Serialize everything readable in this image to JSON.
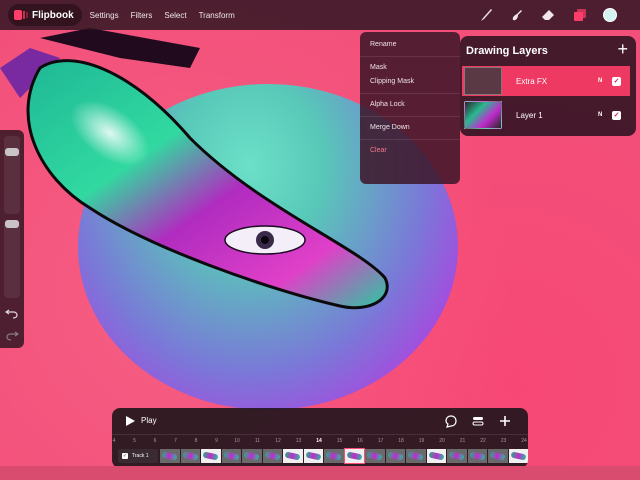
{
  "app": {
    "name": "Flipbook"
  },
  "menu": [
    "Settings",
    "Filters",
    "Select",
    "Transform"
  ],
  "toolbar": {
    "tools": [
      "brush-icon",
      "smudge-icon",
      "eraser-icon",
      "layers-icon"
    ],
    "active_tool": "layers-icon",
    "current_color": "#d4f2f2",
    "accent_color": "#ee3a63"
  },
  "context_menu": {
    "items": [
      {
        "label": "Rename"
      },
      {
        "label": "Mask"
      },
      {
        "label": "Clipping Mask"
      },
      {
        "label": "Alpha Lock"
      },
      {
        "label": "Merge Down"
      },
      {
        "label": "Clear"
      }
    ]
  },
  "layers": {
    "title": "Drawing Layers",
    "items": [
      {
        "name": "Extra FX",
        "blend": "N",
        "visible": true,
        "active": true
      },
      {
        "name": "Layer 1",
        "blend": "N",
        "visible": true,
        "active": false
      }
    ]
  },
  "sidebar": {
    "brush_size_level": 0.1,
    "opacity_level": 0.1,
    "undo_icon": "undo-icon",
    "redo_icon": "redo-icon"
  },
  "timeline": {
    "play_label": "Play",
    "frame_numbers": [
      "4",
      "5",
      "6",
      "7",
      "8",
      "9",
      "10",
      "11",
      "12",
      "13",
      "14",
      "15",
      "16",
      "17",
      "18",
      "19",
      "20",
      "21",
      "22",
      "23",
      "24"
    ],
    "current_frame": "14",
    "track": {
      "name": "Track 1",
      "enabled": true
    }
  }
}
